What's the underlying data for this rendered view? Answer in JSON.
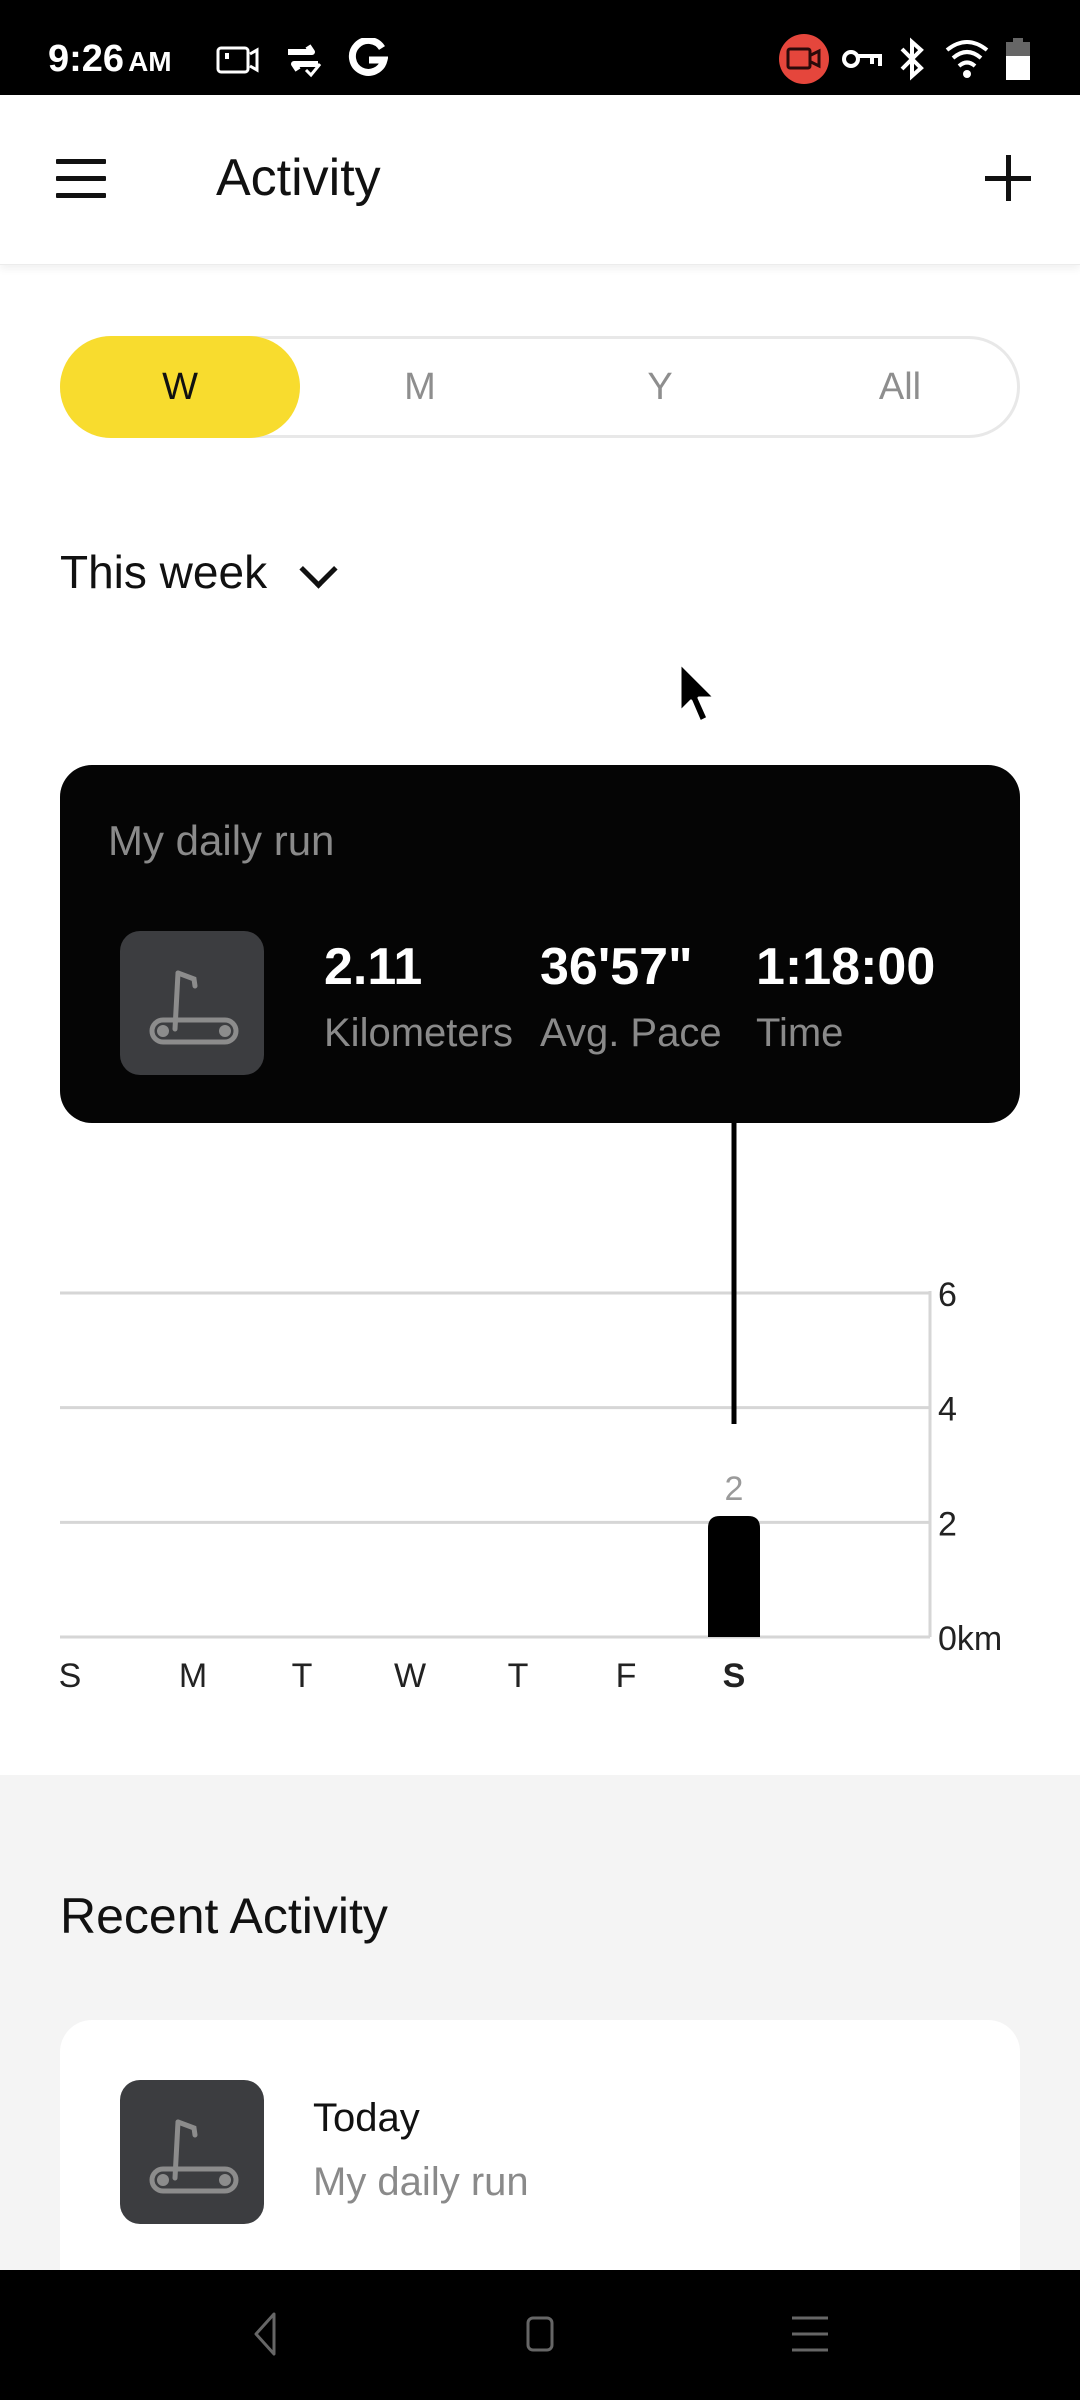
{
  "status_bar": {
    "time": "9:26",
    "ampm": "AM",
    "left_icons": [
      "screen-record-icon",
      "sync-icon",
      "google-icon"
    ],
    "right_icons": [
      "recording-badge-icon",
      "vpn-key-icon",
      "bluetooth-icon",
      "wifi-icon",
      "battery-icon"
    ],
    "recording_color": "#e5463c"
  },
  "app_bar": {
    "title": "Activity",
    "menu_icon": "hamburger-menu-icon",
    "add_icon": "plus-icon"
  },
  "segments": {
    "items": [
      {
        "label": "W",
        "active": true
      },
      {
        "label": "M",
        "active": false
      },
      {
        "label": "Y",
        "active": false
      },
      {
        "label": "All",
        "active": false
      }
    ],
    "accent_color": "#f8dc2e"
  },
  "period": {
    "label": "This week"
  },
  "summary_card": {
    "title": "My daily run",
    "icon": "treadmill-icon",
    "stats": [
      {
        "value": "2.11",
        "label": "Kilometers"
      },
      {
        "value": "36'57\"",
        "label": "Avg. Pace"
      },
      {
        "value": "1:18:00",
        "label": "Time"
      }
    ]
  },
  "chart_data": {
    "type": "bar",
    "title": "",
    "xlabel": "",
    "ylabel": "km",
    "categories": [
      "S",
      "M",
      "T",
      "W",
      "T",
      "F",
      "S"
    ],
    "values": [
      0,
      0,
      0,
      0,
      0,
      0,
      2.11
    ],
    "selected_index": 6,
    "bar_label": "2",
    "y_ticks": [
      "0km",
      "2",
      "4",
      "6"
    ],
    "y_tick_values": [
      0,
      2,
      4,
      6
    ],
    "ylim": [
      0,
      6
    ],
    "grid": true,
    "axis_position": "right"
  },
  "recent": {
    "title": "Recent Activity",
    "items": [
      {
        "date": "Today",
        "name": "My daily run",
        "icon": "treadmill-icon"
      }
    ]
  },
  "nav_bar": {
    "buttons": [
      "back-icon",
      "home-icon",
      "recents-icon"
    ]
  }
}
